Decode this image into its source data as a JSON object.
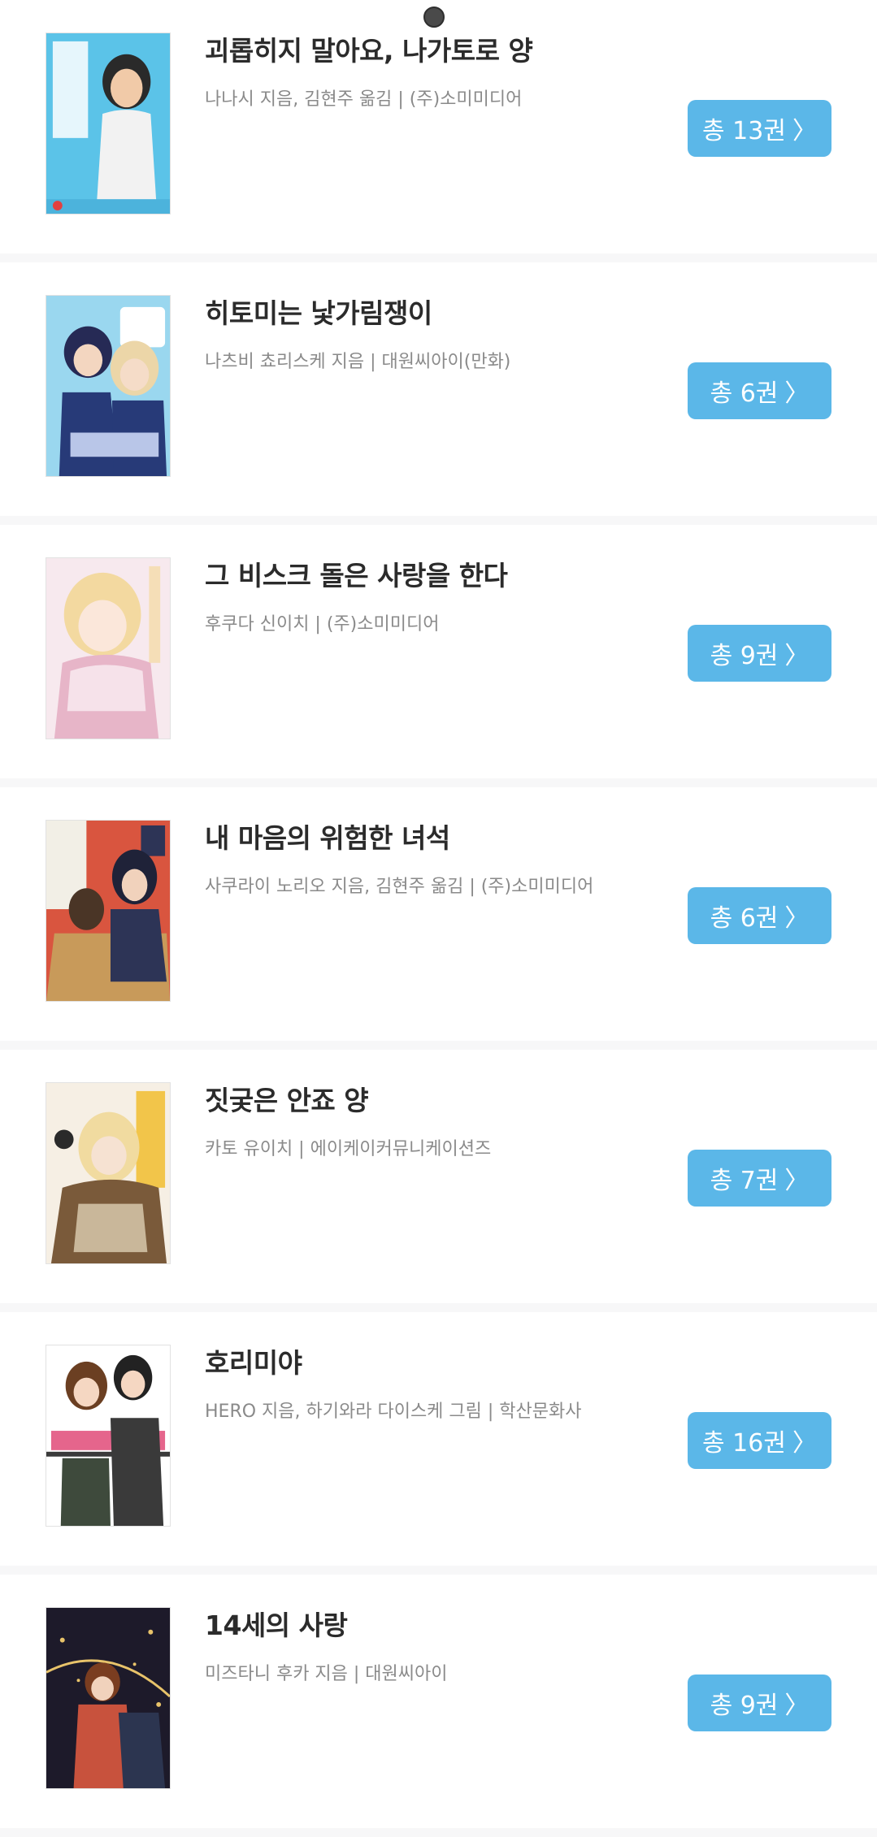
{
  "books": [
    {
      "title": "괴롭히지 말아요, 나가토로 양",
      "meta": "나나시 지음, 김현주 옮김 | (주)소미미디어",
      "volumes_label": "총 13권",
      "cover_colors": [
        "#5bc3e8",
        "#f2f2f2",
        "#2a2a2a"
      ]
    },
    {
      "title": "히토미는 낯가림쟁이",
      "meta": "나츠비 쵸리스케 지음 | 대원씨아이(만화)",
      "volumes_label": "총 6권",
      "cover_colors": [
        "#9ad7ef",
        "#273a78",
        "#e8c7a6"
      ]
    },
    {
      "title": "그 비스크 돌은 사랑을 한다",
      "meta": "후쿠다 신이치 | (주)소미미디어",
      "volumes_label": "총 9권",
      "cover_colors": [
        "#f7e9ee",
        "#f3d9a0",
        "#e7b5c8"
      ]
    },
    {
      "title": "내 마음의 위험한 녀석",
      "meta": "사쿠라이 노리오 지음, 김현주 옮김 | (주)소미미디어",
      "volumes_label": "총 6권",
      "cover_colors": [
        "#d9553f",
        "#2d3456",
        "#c89a5a"
      ]
    },
    {
      "title": "짓궂은 안죠 양",
      "meta": "카토 유이치 | 에이케이커뮤니케이션즈",
      "volumes_label": "총 7권",
      "cover_colors": [
        "#f6efe4",
        "#f2c54a",
        "#7a5a3a"
      ]
    },
    {
      "title": "호리미야",
      "meta": "HERO 지음, 하기와라 다이스케 그림 | 학산문화사",
      "volumes_label": "총 16권",
      "cover_colors": [
        "#ffffff",
        "#e14a78",
        "#3a3a3a"
      ]
    },
    {
      "title": "14세의 사랑",
      "meta": "미즈타니 후카 지음 | 대원씨아이",
      "volumes_label": "총 9권",
      "cover_colors": [
        "#1d1a2a",
        "#c8523d",
        "#e8c36a"
      ]
    }
  ],
  "chevron_glyph": "〉",
  "accent_color": "#5bb7e8"
}
